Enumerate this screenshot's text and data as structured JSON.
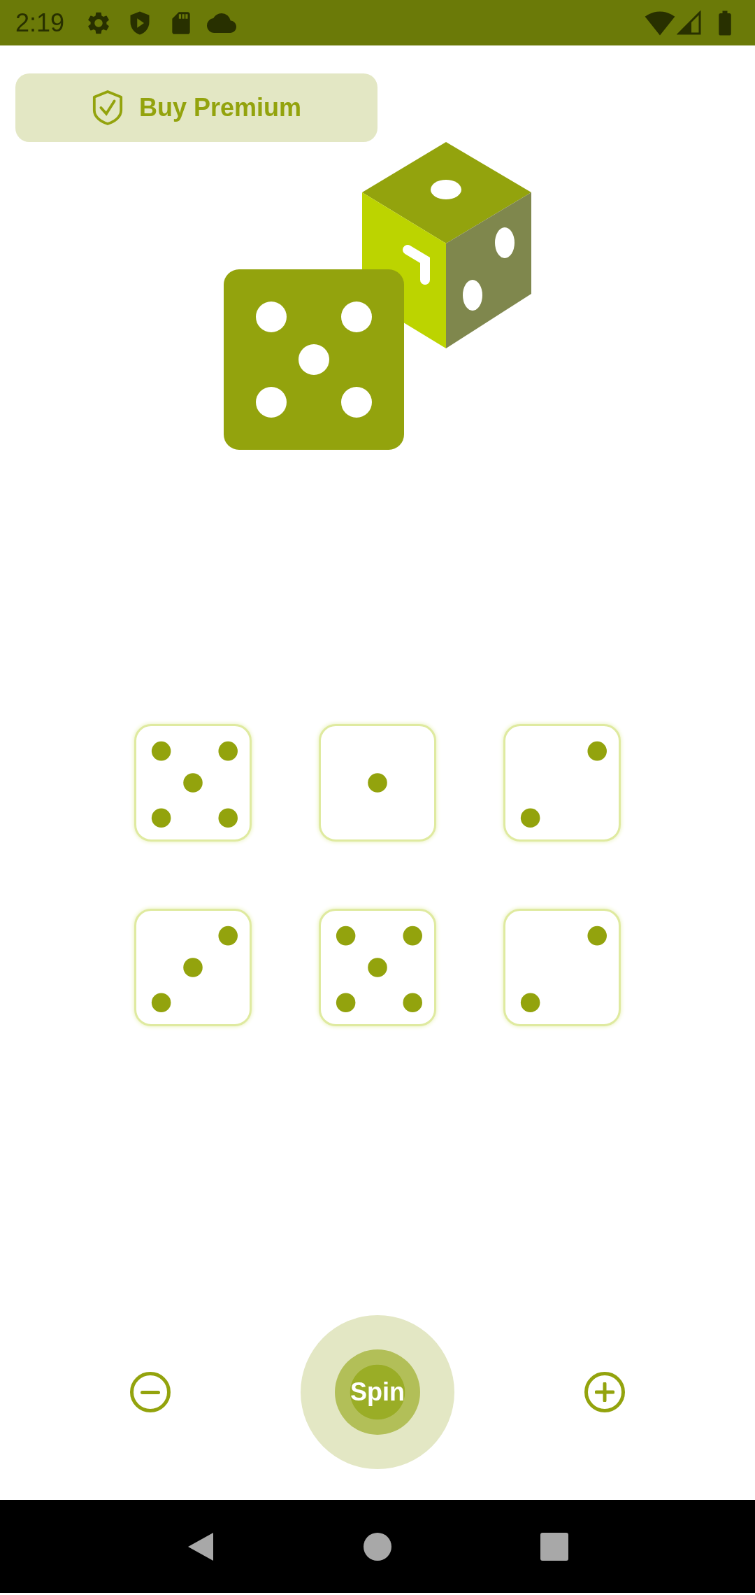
{
  "status_bar": {
    "time": "2:19"
  },
  "premium_button": {
    "label": "Buy Premium"
  },
  "dice": [
    {
      "kind": "five"
    },
    {
      "kind": "one"
    },
    {
      "kind": "two"
    },
    {
      "kind": "three"
    },
    {
      "kind": "five"
    },
    {
      "kind": "two"
    }
  ],
  "spin_button": {
    "label": "Spin"
  }
}
